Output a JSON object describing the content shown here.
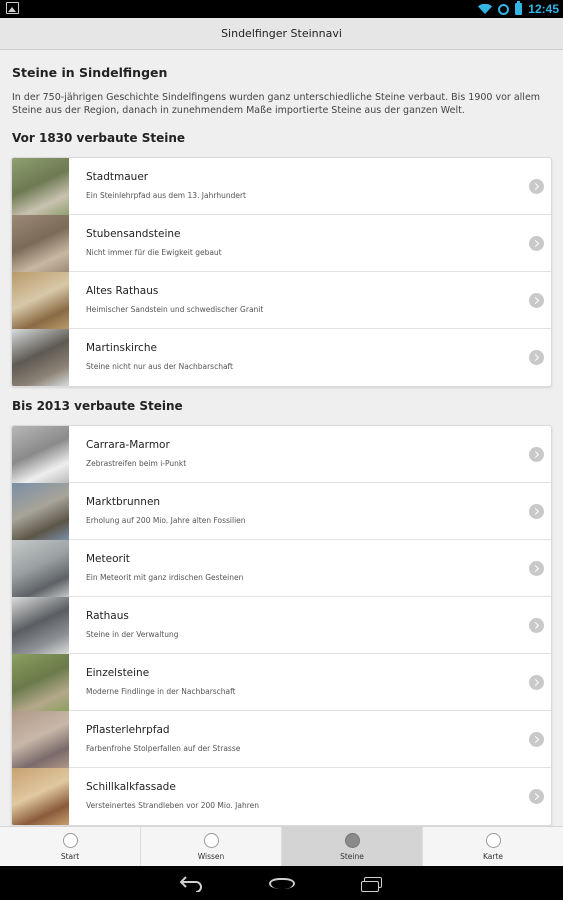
{
  "status_bar": {
    "time": "12:45"
  },
  "app_title": "Sindelfinger Steinnavi",
  "main_heading": "Steine in Sindelfingen",
  "intro_text": "In der 750-jährigen Geschichte Sindelfingens wurden ganz unterschiedliche Steine verbaut. Bis 1900 vor allem Steine aus der Region, danach in zunehmendem Maße importierte Steine aus der ganzen Welt.",
  "sections": [
    {
      "heading": "Vor 1830 verbaute Steine",
      "items": [
        {
          "title": "Stadtmauer",
          "subtitle": "Ein Steinlehrpfad aus dem 13. Jahrhundert",
          "thumb_colors": [
            "#8fa070",
            "#c9c2b0",
            "#6d7a52"
          ]
        },
        {
          "title": "Stubensandsteine",
          "subtitle": "Nicht immer für die Ewigkeit gebaut",
          "thumb_colors": [
            "#9c8a76",
            "#c8b8a2",
            "#7a6a58"
          ]
        },
        {
          "title": "Altes Rathaus",
          "subtitle": "Heimischer Sandstein und schwedischer Granit",
          "thumb_colors": [
            "#b99a6a",
            "#8a6a44",
            "#d8c8a8"
          ]
        },
        {
          "title": "Martinskirche",
          "subtitle": "Steine nicht nur aus der Nachbarschaft",
          "thumb_colors": [
            "#d8dcde",
            "#8c8276",
            "#5e5a52"
          ]
        }
      ]
    },
    {
      "heading": "Bis 2013 verbaute Steine",
      "items": [
        {
          "title": "Carrara-Marmor",
          "subtitle": "Zebrastreifen beim i-Punkt",
          "thumb_colors": [
            "#b8b8b8",
            "#efefef",
            "#8a8a8a"
          ]
        },
        {
          "title": "Marktbrunnen",
          "subtitle": "Erholung auf 200 Mio. Jahre alten Fossilien",
          "thumb_colors": [
            "#7a8ea6",
            "#5c5648",
            "#a8a49a"
          ]
        },
        {
          "title": "Meteorit",
          "subtitle": "Ein Meteorit mit ganz irdischen Gesteinen",
          "thumb_colors": [
            "#c4c8c8",
            "#5e6266",
            "#9aa0a2"
          ]
        },
        {
          "title": "Rathaus",
          "subtitle": "Steine in der Verwaltung",
          "thumb_colors": [
            "#dcdcdc",
            "#8e9296",
            "#5a5e62"
          ]
        },
        {
          "title": "Einzelsteine",
          "subtitle": "Moderne Findlinge in der Nachbarschaft",
          "thumb_colors": [
            "#8aa060",
            "#b4a88a",
            "#6a7a4a"
          ]
        },
        {
          "title": "Pflasterlehrpfad",
          "subtitle": "Farbenfrohe Stolperfallen auf der Strasse",
          "thumb_colors": [
            "#b09888",
            "#7a6a6a",
            "#c8b8a8"
          ]
        },
        {
          "title": "Schillkalkfassade",
          "subtitle": "Versteinertes Strandleben vor 200 Mio. Jahren",
          "thumb_colors": [
            "#c8a070",
            "#8a5a3a",
            "#e0c8a0"
          ]
        }
      ]
    }
  ],
  "tabs": [
    {
      "label": "Start",
      "icon": "home-icon",
      "active": false
    },
    {
      "label": "Wissen",
      "icon": "book-icon",
      "active": false
    },
    {
      "label": "Steine",
      "icon": "stone-icon",
      "active": true
    },
    {
      "label": "Karte",
      "icon": "map-icon",
      "active": false
    }
  ],
  "colors": {
    "accent_status": "#33b5e5",
    "active_tab": "#d4d4d4"
  }
}
